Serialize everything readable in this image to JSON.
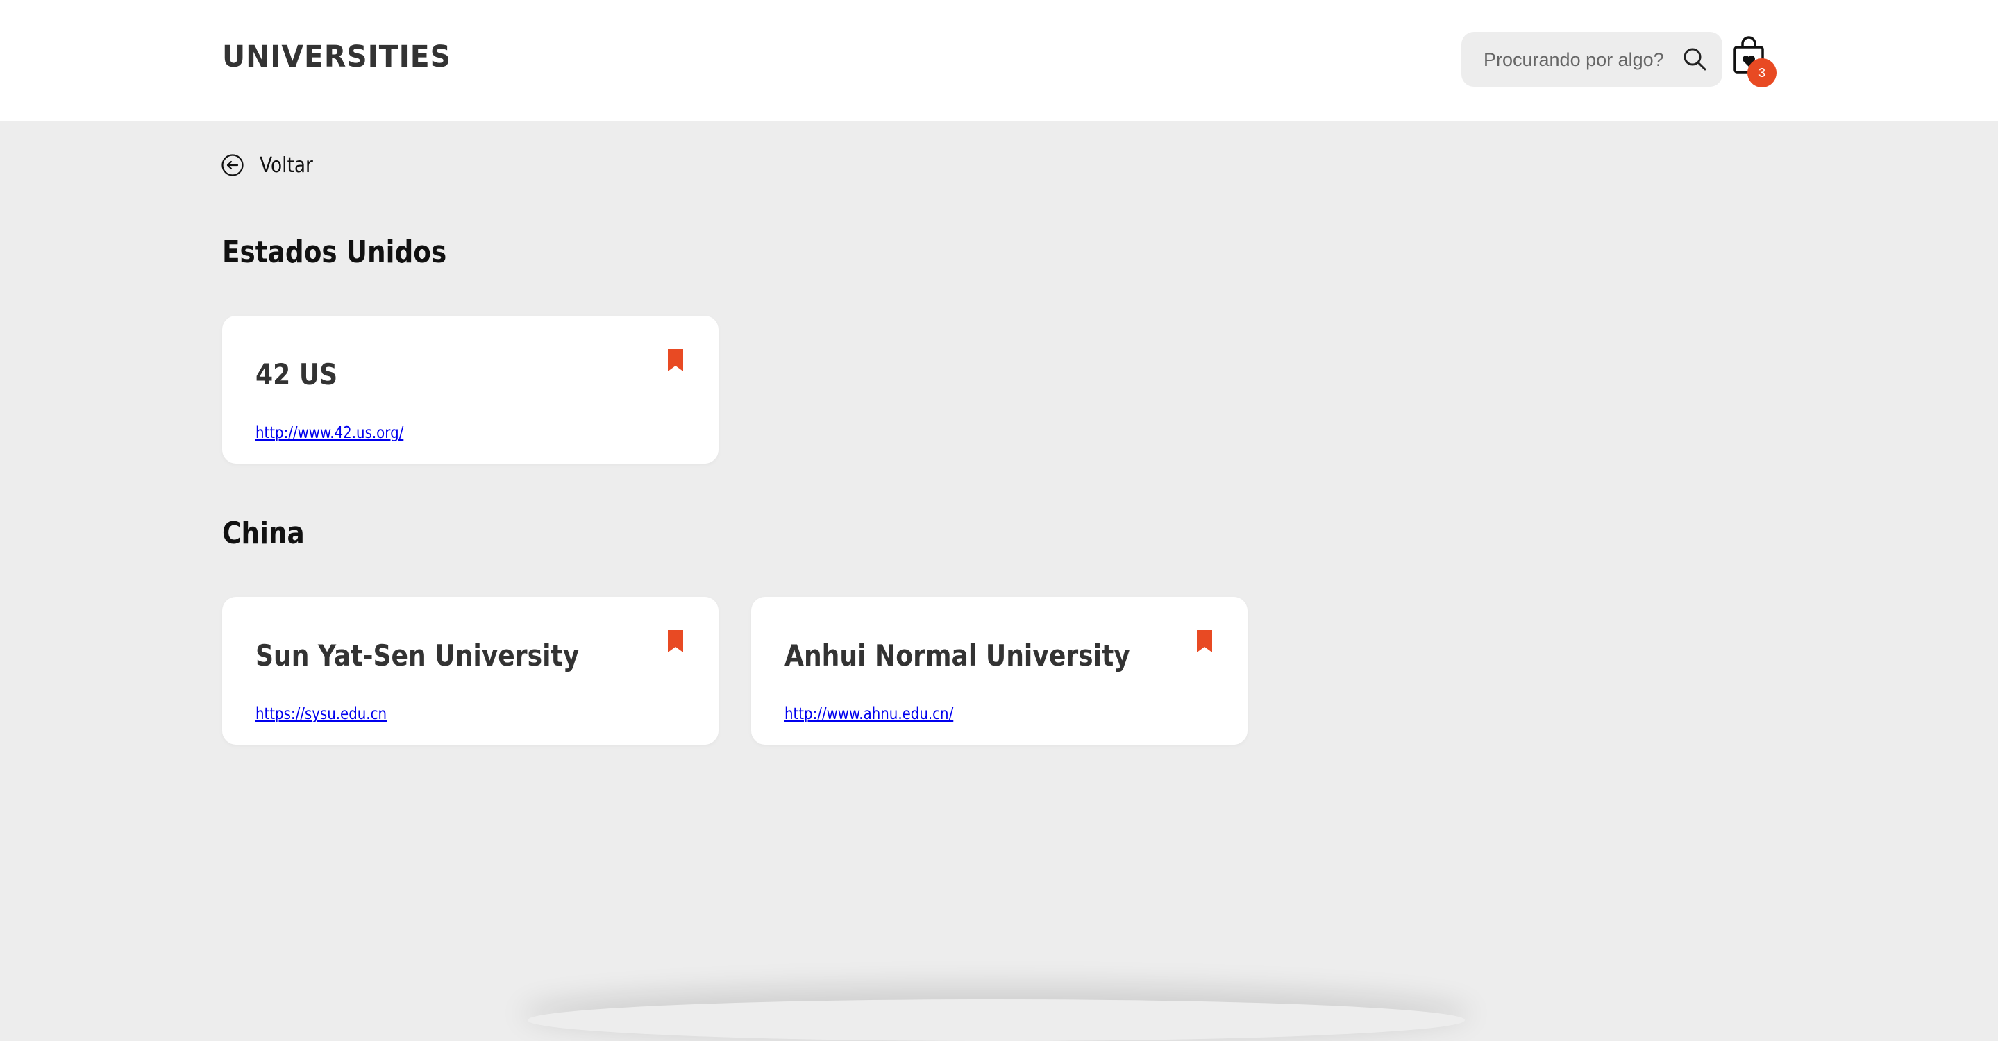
{
  "header": {
    "logo": "UNIVERSITIES",
    "search": {
      "placeholder": "Procurando por algo?",
      "value": ""
    },
    "cart": {
      "count": "3"
    }
  },
  "back": {
    "label": "Voltar"
  },
  "sections": [
    {
      "title": "Estados Unidos",
      "cards": [
        {
          "name": "42 US",
          "url": "http://www.42.us.org/"
        }
      ]
    },
    {
      "title": "China",
      "cards": [
        {
          "name": "Sun Yat-Sen University",
          "url": "https://sysu.edu.cn"
        },
        {
          "name": "Anhui Normal University",
          "url": "http://www.ahnu.edu.cn/"
        }
      ]
    }
  ],
  "colors": {
    "accent": "#e84a23",
    "background": "#ededed",
    "header": "#ffffff",
    "link": "#0000ee"
  }
}
